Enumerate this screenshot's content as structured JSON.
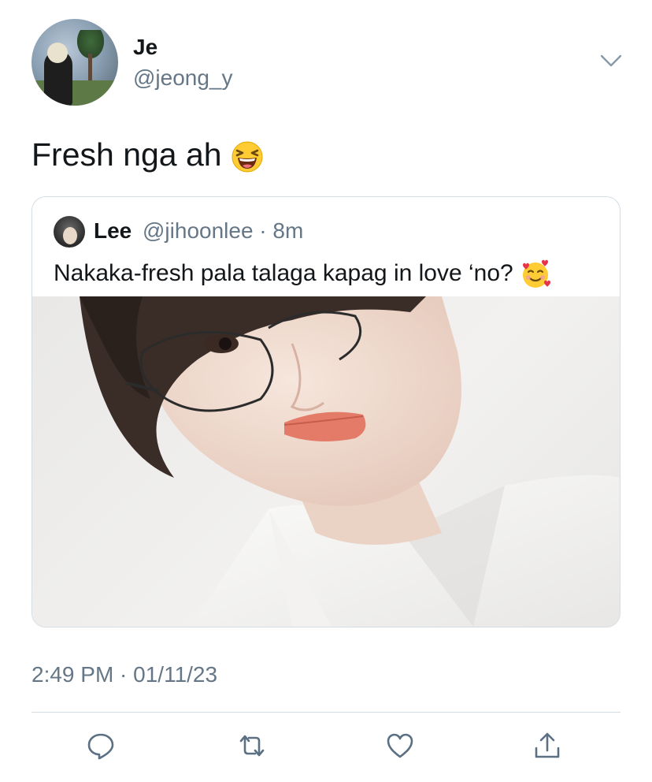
{
  "tweet": {
    "author": {
      "display_name": "Je",
      "handle": "@jeong_y"
    },
    "text": "Fresh nga ah",
    "emoji": "laughing-squinting-face",
    "timestamp": "2:49 PM · 01/11/23"
  },
  "quoted_tweet": {
    "author": {
      "display_name": "Lee",
      "handle_time": "@jihoonlee · 8m"
    },
    "text": "Nakaka-fresh pala talaga kapag in love ‘no?",
    "emoji": "smiling-face-with-hearts",
    "photo_description_icon": "portrait-photo"
  },
  "actions": [
    {
      "name": "reply",
      "icon": "speech-bubble-icon"
    },
    {
      "name": "retweet",
      "icon": "retweet-arrows-icon"
    },
    {
      "name": "like",
      "icon": "heart-icon"
    },
    {
      "name": "share",
      "icon": "share-upload-icon"
    }
  ],
  "colors": {
    "text_primary": "#14171a",
    "text_secondary": "#657786",
    "border": "#d5dde3",
    "icon": "#5b7083"
  }
}
